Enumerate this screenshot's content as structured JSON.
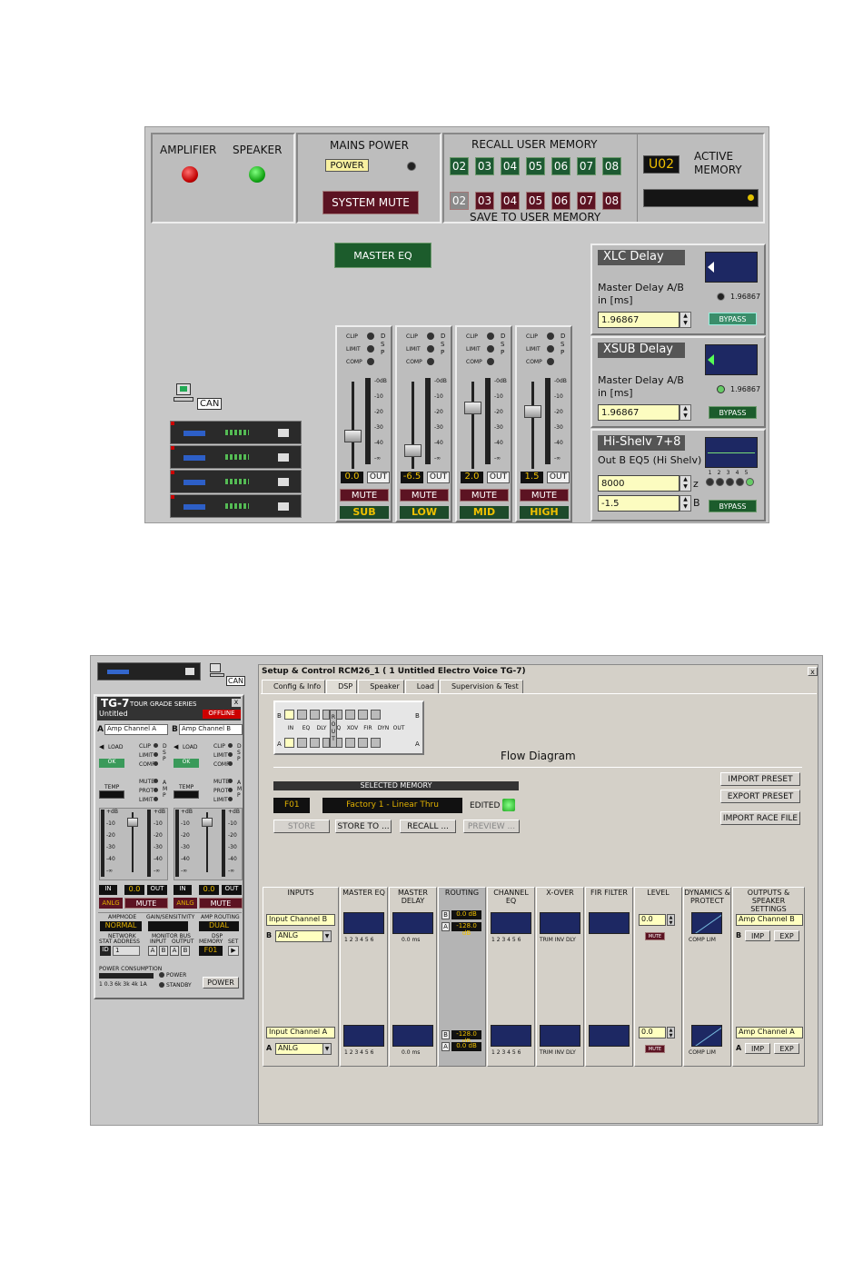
{
  "top": {
    "status": {
      "amplifier": "AMPLIFIER",
      "speaker": "SPEAKER"
    },
    "mains": {
      "title": "MAINS POWER",
      "power": "POWER",
      "system_mute": "SYSTEM MUTE"
    },
    "memory": {
      "recall_title": "RECALL USER MEMORY",
      "save_title": "SAVE TO USER MEMORY",
      "recall_slots": [
        "02",
        "03",
        "04",
        "05",
        "06",
        "07",
        "08"
      ],
      "save_slots": [
        "02",
        "03",
        "04",
        "05",
        "06",
        "07",
        "08"
      ],
      "active_value": "U02",
      "active_label_1": "ACTIVE",
      "active_label_2": "MEMORY"
    },
    "master_eq": "MASTER EQ",
    "can": "CAN",
    "faders": {
      "led_labels": [
        "CLIP",
        "LIMIT",
        "COMP"
      ],
      "dsp": "DSP",
      "scale": [
        "-0dB",
        "-10",
        "-20",
        "-30",
        "-40",
        "-∞"
      ],
      "out": "OUT",
      "mute": "MUTE",
      "channels": [
        {
          "name": "SUB",
          "value": "0.0",
          "level": 0.38
        },
        {
          "name": "LOW",
          "value": "-6.5",
          "level": 0.2
        },
        {
          "name": "MID",
          "value": "2.0",
          "level": 0.75
        },
        {
          "name": "HIGH",
          "value": "1.5",
          "level": 0.7
        }
      ]
    },
    "xlc": {
      "title": "XLC Delay",
      "label_1": "Master Delay A/B",
      "label_2": "in [ms]",
      "value": "1.96867",
      "readout": "1.96867",
      "bypass": "BYPASS"
    },
    "xsub": {
      "title": "XSUB Delay",
      "label_1": "Master Delay A/B",
      "label_2": "in [ms]",
      "value": "1.96867",
      "readout": "1.96867",
      "bypass": "BYPASS"
    },
    "hishelv": {
      "title": "Hi-Shelv 7+8",
      "label": "Out B EQ5 (Hi Shelv)",
      "freq": "8000",
      "gain": "-1.5",
      "unit_z": "z",
      "unit_b": "B",
      "bands": [
        "1",
        "2",
        "3",
        "4",
        "5"
      ],
      "bypass": "BYPASS"
    }
  },
  "bottom": {
    "tg7": {
      "title": "TG-7",
      "series": "TOUR GRADE SERIES",
      "name": "Untitled",
      "status": "OFFLINE",
      "ch_a_tag": "A",
      "ch_a": "Amp Channel A",
      "ch_b_tag": "B",
      "ch_b": "Amp Channel B",
      "load": "LOAD",
      "ok": "OK",
      "led_labels": [
        "CLIP",
        "LIMIT",
        "COMP"
      ],
      "dsp": "DSP",
      "temp": "TEMP",
      "amp_leds": [
        "MUTE",
        "PROT",
        "LIMIT"
      ],
      "amp": "AMP",
      "scale": [
        "+dB",
        "-10",
        "-20",
        "-30",
        "-40",
        "-∞"
      ],
      "in": "IN",
      "val": "0.0",
      "out": "OUT",
      "anlg": "ANLG",
      "mute": "MUTE",
      "ampmode_label": "AMPMODE",
      "ampmode": "NORMAL",
      "gain_label": "GAIN/SENSITIVITY",
      "routing_label": "AMP ROUTING",
      "routing": "DUAL",
      "network": "NETWORK",
      "stat": "STAT",
      "address": "ADDRESS",
      "addr_val": "1",
      "addr_tag": "ID",
      "monitor": "MONITOR BUS",
      "input": "INPUT",
      "output": "OUTPUT",
      "mon_tags": [
        "A",
        "B",
        "A",
        "B"
      ],
      "dsp_mem": "DSP",
      "memory": "MEMORY",
      "set": "SET",
      "mem_val": "F01",
      "power_cons": "POWER CONSUMPTION",
      "power_scale": "1  0.3  6k  3k  4k  1A",
      "power_led": "POWER",
      "standby_led": "STANDBY",
      "power_btn": "POWER"
    },
    "window": {
      "title": "Setup & Control RCM26_1 ( 1 Untitled Electro Voice TG-7)",
      "close": "x",
      "tabs": [
        "Config & Info",
        "DSP",
        "Speaker",
        "Load",
        "Supervision & Test"
      ],
      "flow_title": "Flow Diagram",
      "flow_nodes": [
        "IN",
        "EQ",
        "DLY",
        "EQ",
        "XOV",
        "FIR",
        "DYN",
        "OUT"
      ],
      "flow_routing": "ROUT",
      "flow_b": "B",
      "flow_a": "A",
      "selected_memory": "SELECTED MEMORY",
      "mem_id": "F01",
      "mem_name": "Factory 1 - Linear Thru",
      "edited": "EDITED",
      "store": "STORE",
      "store_to": "STORE TO ...",
      "recall": "RECALL ...",
      "preview": "PREVIEW ...",
      "import_preset": "IMPORT PRESET",
      "export_preset": "EXPORT PRESET",
      "import_race": "IMPORT RACE FILE",
      "columns": [
        "INPUTS",
        "MASTER EQ",
        "MASTER DELAY",
        "ROUTING",
        "CHANNEL EQ",
        "X-OVER",
        "FIR FILTER",
        "LEVEL",
        "DYNAMICS & PROTECT",
        "OUTPUTS & SPEAKER SETTINGS"
      ],
      "row_b": {
        "tag": "B",
        "input": "Input Channel B",
        "source": "ANLG",
        "route_b": "0.0 dB",
        "route_a": "-128.0 dB",
        "level": "0.0",
        "output": "Amp Channel B"
      },
      "row_a": {
        "tag": "A",
        "input": "Input Channel A",
        "source": "ANLG",
        "route_b": "-128.0 dB",
        "route_a": "0.0 dB",
        "level": "0.0",
        "output": "Amp Channel A"
      },
      "eq_bands": "1 2 3 4 5 6",
      "xover_labels": "TRIM  INV  DLY",
      "delay_val": "0.0 ms",
      "mute": "MUTE",
      "comp_lim": "COMP  LIM",
      "imp": "IMP",
      "exp": "EXP"
    }
  }
}
